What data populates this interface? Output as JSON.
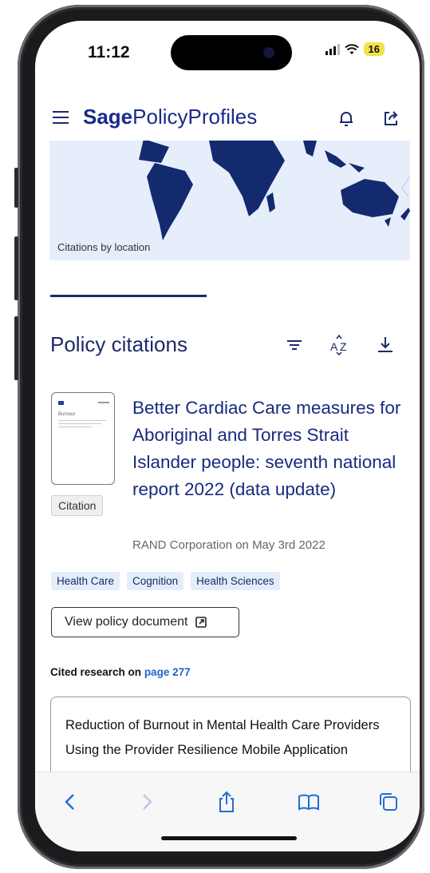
{
  "status_bar": {
    "time": "11:12",
    "battery": "16"
  },
  "app": {
    "logo_bold": "Sage",
    "logo_light": "PolicyProfiles"
  },
  "map": {
    "caption": "Citations by location"
  },
  "section": {
    "title": "Policy citations"
  },
  "citation": {
    "thumb_word": "Burnout",
    "badge": "Citation",
    "title": "Better Cardiac Care measures for Aboriginal and Torres Strait Islander people: seventh national report 2022 (data update)",
    "meta": "RAND Corporation on May 3rd 2022",
    "tags": [
      "Health Care",
      "Cognition",
      "Health Sciences"
    ],
    "view_button": "View policy document"
  },
  "cited": {
    "prefix": "Cited research on",
    "link": "page 277"
  },
  "research_card": {
    "title": "Reduction of Burnout in Mental Health Care Providers Using the Provider Resilience Mobile Application"
  },
  "colors": {
    "brand": "#1a2a8a",
    "link": "#1f63c7",
    "tag_bg": "#e4eefb",
    "map_land": "#132a6f"
  },
  "icons": [
    "menu-icon",
    "bell-icon",
    "share-icon",
    "filter-icon",
    "sort-az-icon",
    "download-icon",
    "external-link-icon",
    "back-icon",
    "forward-icon",
    "share-sheet-icon",
    "bookmarks-icon",
    "tabs-icon"
  ]
}
